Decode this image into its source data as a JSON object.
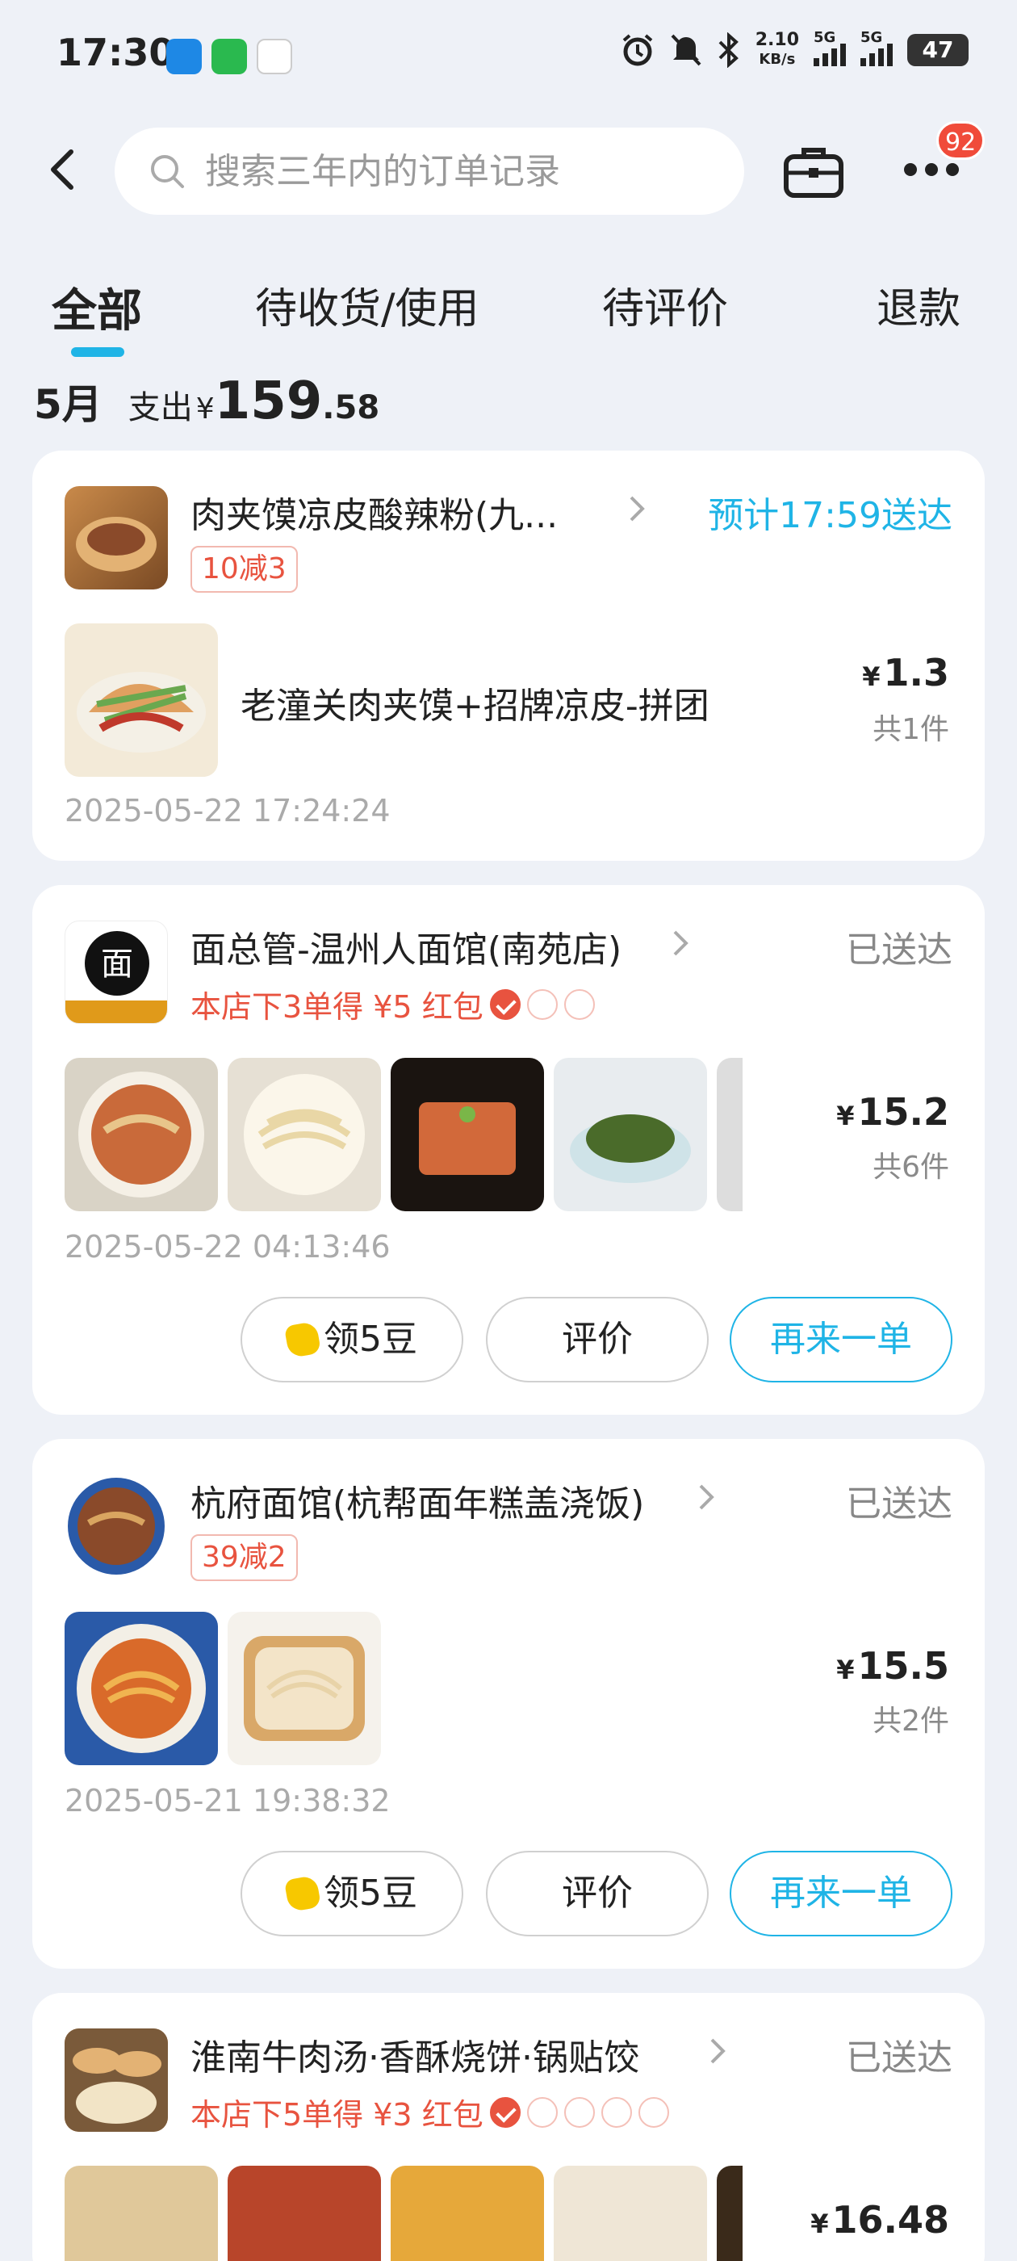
{
  "status_bar": {
    "time": "17:30",
    "net_speed_value": "2.10",
    "net_speed_unit": "KB/s",
    "signal_1": "5G",
    "signal_2": "5G",
    "battery": "47",
    "icons": [
      "ele-me-app-icon",
      "wechat-icon",
      "notification-icon",
      "alarm-icon",
      "mute-icon",
      "bluetooth-icon"
    ]
  },
  "header": {
    "search_placeholder": "搜索三年内的订单记录",
    "message_badge": "92"
  },
  "tabs": [
    {
      "label": "全部",
      "active": true
    },
    {
      "label": "待收货/使用",
      "active": false
    },
    {
      "label": "待评价",
      "active": false
    },
    {
      "label": "退款",
      "active": false
    }
  ],
  "summary": {
    "month": "5月",
    "spend_label": "支出",
    "currency": "¥",
    "amount_int": "159",
    "amount_dec": ".58"
  },
  "orders": [
    {
      "shop": "肉夹馍凉皮酸辣粉(九...",
      "status": "预计17:59送达",
      "promo": "10减3",
      "item_name": "老潼关肉夹馍+招牌凉皮-拼团",
      "currency": "¥",
      "price": "1.3",
      "qty": "共1件",
      "time": "2025-05-22 17:24:24"
    },
    {
      "shop": "面总管-温州人面馆(南苑店)",
      "status": "已送达",
      "promo": "本店下3单得 ¥5 红包",
      "currency": "¥",
      "price": "15.2",
      "qty": "共6件",
      "time": "2025-05-22 04:13:46",
      "buttons": [
        "领5豆",
        "评价",
        "再来一单"
      ]
    },
    {
      "shop": "杭府面馆(杭帮面年糕盖浇饭)",
      "status": "已送达",
      "promo": "39减2",
      "currency": "¥",
      "price": "15.5",
      "qty": "共2件",
      "time": "2025-05-21 19:38:32",
      "buttons": [
        "领5豆",
        "评价",
        "再来一单"
      ]
    },
    {
      "shop": "淮南牛肉汤·香酥烧饼·锅贴饺",
      "status": "已送达",
      "promo": "本店下5单得 ¥3 红包",
      "currency": "¥",
      "price": "16.48"
    }
  ]
}
